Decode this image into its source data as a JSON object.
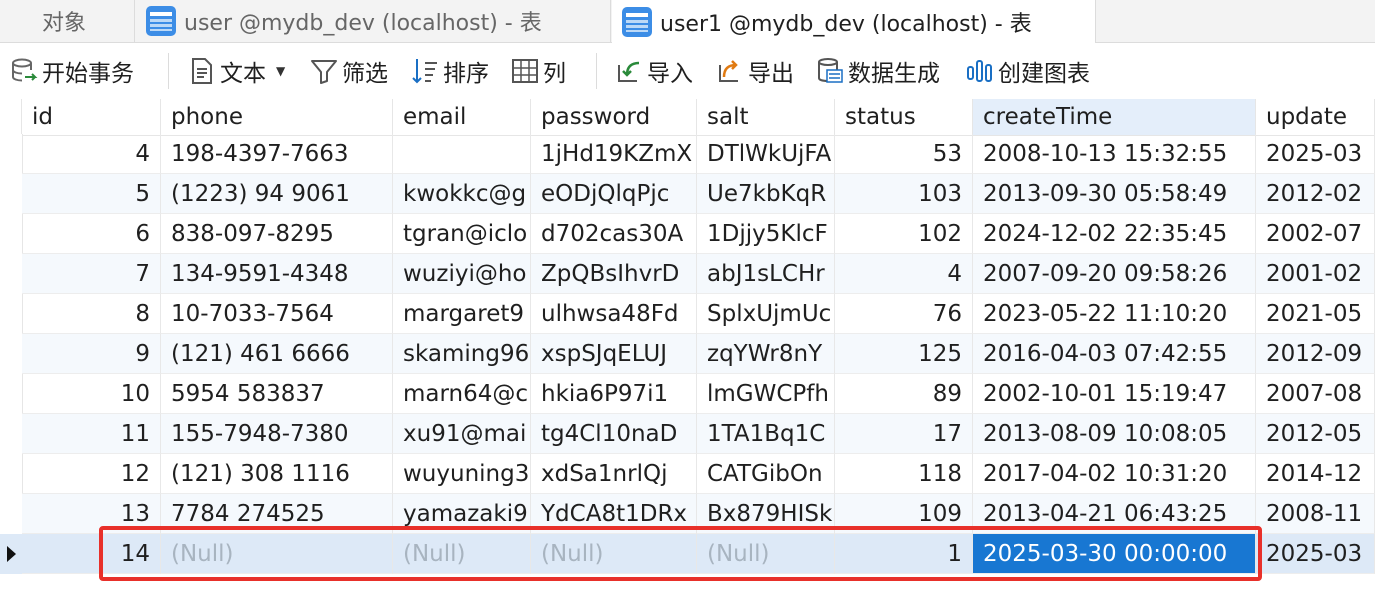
{
  "tabs": [
    {
      "label": "对象"
    },
    {
      "label": "user @mydb_dev (localhost) - 表"
    },
    {
      "label": "user1 @mydb_dev (localhost) - 表"
    }
  ],
  "toolbar": {
    "begin_transaction": "开始事务",
    "text": "文本",
    "filter": "筛选",
    "sort": "排序",
    "columns": "列",
    "import": "导入",
    "export": "导出",
    "data_gen": "数据生成",
    "create_chart": "创建图表"
  },
  "columns": [
    "id",
    "phone",
    "email",
    "password",
    "salt",
    "status",
    "createTime",
    "update"
  ],
  "rows": [
    [
      "4",
      "198-4397-7663",
      "",
      "1jHd19KZmX",
      "DTlWkUjFA",
      "53",
      "2008-10-13 15:32:55",
      "2025-03"
    ],
    [
      "5",
      "(1223) 94 9061",
      "kwokkc@g",
      "eODjQlqPjc",
      "Ue7kbKqR",
      "103",
      "2013-09-30 05:58:49",
      "2012-02"
    ],
    [
      "6",
      "838-097-8295",
      "tgran@iclo",
      "d702cas30A",
      "1Djjy5KlcF",
      "102",
      "2024-12-02 22:35:45",
      "2002-07"
    ],
    [
      "7",
      "134-9591-4348",
      "wuziyi@ho",
      "ZpQBsIhvrD",
      "abJ1sLCHr",
      "4",
      "2007-09-20 09:58:26",
      "2001-02"
    ],
    [
      "8",
      "10-7033-7564",
      "margaret9",
      "ulhwsa48Fd",
      "SplxUjmUc",
      "76",
      "2023-05-22 11:10:20",
      "2021-05"
    ],
    [
      "9",
      "(121) 461 6666",
      "skaming96",
      "xspSJqELUJ",
      "zqYWr8nY",
      "125",
      "2016-04-03 07:42:55",
      "2012-09"
    ],
    [
      "10",
      "5954 583837",
      "marn64@c",
      "hkia6P97i1",
      "lmGWCPfh",
      "89",
      "2002-10-01 15:19:47",
      "2007-08"
    ],
    [
      "11",
      "155-7948-7380",
      "xu91@mai",
      "tg4Cl10naD",
      "1TA1Bq1C",
      "17",
      "2013-08-09 10:08:05",
      "2012-05"
    ],
    [
      "12",
      "(121) 308 1116",
      "wuyuning3",
      "xdSa1nrlQj",
      "CATGibOn",
      "118",
      "2017-04-02 10:31:20",
      "2014-12"
    ],
    [
      "13",
      "7784 274525",
      "yamazaki9",
      "YdCA8t1DRx",
      "Bx879HISk",
      "109",
      "2013-04-21 06:43:25",
      "2008-11"
    ],
    [
      "14",
      "(Null)",
      "(Null)",
      "(Null)",
      "(Null)",
      "1",
      "2025-03-30 00:00:00",
      "2025-03"
    ]
  ]
}
